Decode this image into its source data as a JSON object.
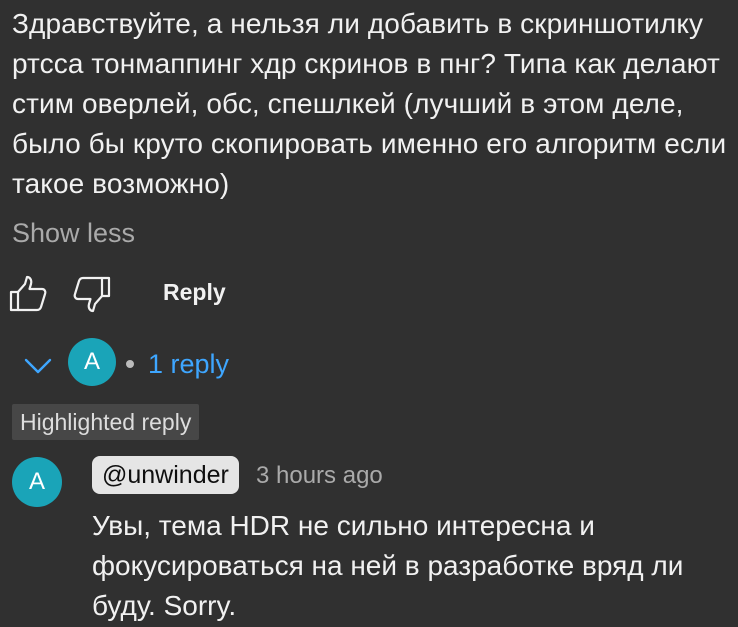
{
  "comment": {
    "text": "Здравствуйте, а нельзя ли добавить в скриншотилку ртсса тонмаппинг хдр скринов в пнг? Типа как делают стим оверлей, обс, спешлкей (лучший в этом деле, было бы круто скопировать именно его алгоритм если такое возможно)",
    "show_less_label": "Show less"
  },
  "actions": {
    "like_icon": "thumbs-up-icon",
    "dislike_icon": "thumbs-down-icon",
    "reply_label": "Reply"
  },
  "replies": {
    "toggle_icon": "chevron-down-icon",
    "avatar_letter": "A",
    "count_label": "1 reply"
  },
  "highlighted_reply": {
    "badge_label": "Highlighted reply",
    "avatar_letter": "A",
    "author": "@unwinder",
    "timestamp": "3 hours ago",
    "text": "Увы, тема HDR не сильно интересна и фокусироваться на ней в разработке вряд ли буду. Sorry."
  },
  "colors": {
    "background": "#303030",
    "avatar": "#1aa4b8",
    "link": "#3ea6ff",
    "secondary_text": "#aaaaaa"
  }
}
